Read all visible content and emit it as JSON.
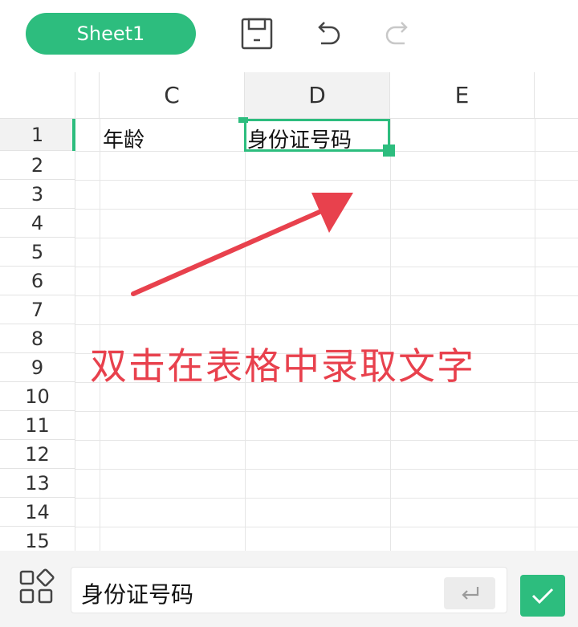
{
  "toolbar": {
    "sheet_tab_label": "Sheet1",
    "icons": [
      "save-icon",
      "undo-icon",
      "redo-icon"
    ]
  },
  "grid": {
    "column_headers": [
      "C",
      "D",
      "E"
    ],
    "row_headers": [
      "1",
      "2",
      "3",
      "4",
      "5",
      "6",
      "7",
      "8",
      "9",
      "10",
      "11",
      "12",
      "13",
      "14",
      "15"
    ],
    "cells": {
      "C1": "年龄",
      "D1": "身份证号码"
    },
    "selected_cell": "D1"
  },
  "annotation": {
    "text": "双击在表格中录取文字",
    "color": "#e8414d"
  },
  "formula_bar": {
    "value": "身份证号码"
  },
  "colors": {
    "accent": "#2dbd7e",
    "annotation": "#e8414d"
  }
}
